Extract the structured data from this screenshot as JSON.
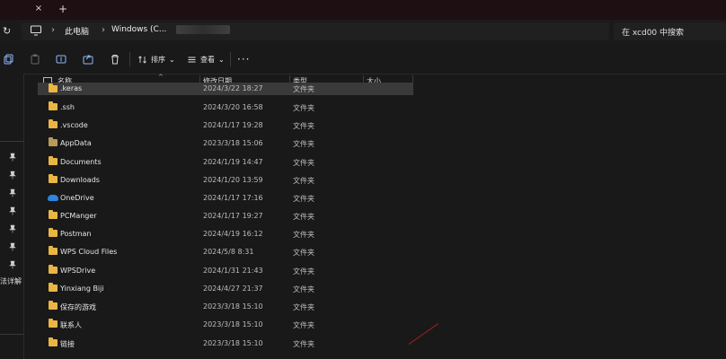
{
  "tabbar": {
    "close_glyph": "×",
    "new_tab_glyph": "+"
  },
  "address": {
    "refresh_glyph": "↻",
    "chevron_glyph": "›",
    "crumbs": [
      "此电脑",
      "Windows (C..."
    ],
    "search_placeholder": "在 xcd00 中搜索"
  },
  "toolbar": {
    "sort_label": "排序",
    "view_label": "查看",
    "dropdown_glyph": "⌄",
    "more_glyph": "···"
  },
  "columns": {
    "name": "名称",
    "modified": "修改日期",
    "type": "类型",
    "size": "大小",
    "sort_glyph": "^"
  },
  "sidebar": {
    "label": "法详解"
  },
  "files": [
    {
      "name": ".keras",
      "modified": "2024/3/22 18:27",
      "type": "文件夹",
      "icon": "folder-icon"
    },
    {
      "name": ".ssh",
      "modified": "2024/3/20 16:58",
      "type": "文件夹",
      "icon": "folder-icon"
    },
    {
      "name": ".vscode",
      "modified": "2024/1/17 19:28",
      "type": "文件夹",
      "icon": "folder-icon"
    },
    {
      "name": "AppData",
      "modified": "2023/3/18 15:06",
      "type": "文件夹",
      "icon": "folder-dark-icon"
    },
    {
      "name": "Documents",
      "modified": "2024/1/19 14:47",
      "type": "文件夹",
      "icon": "folder-icon"
    },
    {
      "name": "Downloads",
      "modified": "2024/1/20 13:59",
      "type": "文件夹",
      "icon": "folder-icon"
    },
    {
      "name": "OneDrive",
      "modified": "2024/1/17 17:16",
      "type": "文件夹",
      "icon": "onedrive-icon"
    },
    {
      "name": "PCManger",
      "modified": "2024/1/17 19:27",
      "type": "文件夹",
      "icon": "folder-icon"
    },
    {
      "name": "Postman",
      "modified": "2024/4/19 16:12",
      "type": "文件夹",
      "icon": "folder-icon"
    },
    {
      "name": "WPS Cloud Files",
      "modified": "2024/5/8 8:31",
      "type": "文件夹",
      "icon": "folder-icon"
    },
    {
      "name": "WPSDrive",
      "modified": "2024/1/31 21:43",
      "type": "文件夹",
      "icon": "folder-icon"
    },
    {
      "name": "Yinxiang Biji",
      "modified": "2024/4/27 21:37",
      "type": "文件夹",
      "icon": "folder-icon"
    },
    {
      "name": "保存的游戏",
      "modified": "2023/3/18 15:10",
      "type": "文件夹",
      "icon": "folder-icon"
    },
    {
      "name": "联系人",
      "modified": "2023/3/18 15:10",
      "type": "文件夹",
      "icon": "folder-icon"
    },
    {
      "name": "链接",
      "modified": "2023/3/18 15:10",
      "type": "文件夹",
      "icon": "folder-icon"
    }
  ],
  "colors": {
    "folder": "#e9b645",
    "folder_dark": "#b89a57",
    "onedrive": "#2b87e0",
    "titlebar": "#1e0f12",
    "background": "#191919"
  }
}
